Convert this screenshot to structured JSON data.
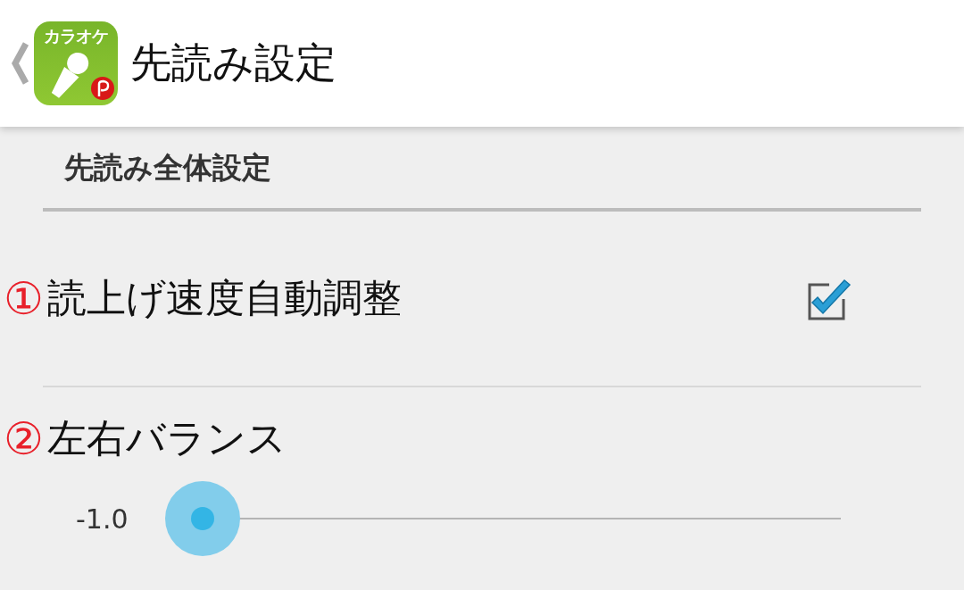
{
  "action_bar": {
    "app_icon_label": "カラオケ",
    "title": "先読み設定"
  },
  "section": {
    "title": "先読み全体設定"
  },
  "items": [
    {
      "kind": "checkbox",
      "number": "①",
      "label": "読上げ速度自動調整",
      "checked": true
    },
    {
      "kind": "slider",
      "number": "②",
      "label": "左右バランス",
      "reading": "-1.0",
      "level": 0
    }
  ]
}
